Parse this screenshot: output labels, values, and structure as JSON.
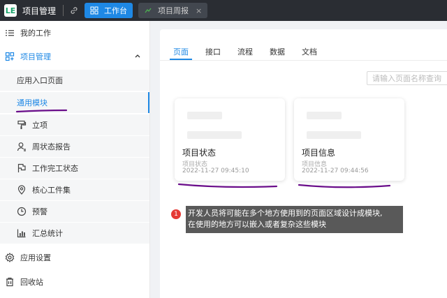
{
  "topbar": {
    "logo_text": "LE",
    "app_title": "项目管理",
    "tabs": [
      {
        "label": "工作台",
        "active": true
      },
      {
        "label": "项目周报",
        "active": false,
        "close": "×"
      }
    ]
  },
  "sidebar": {
    "items": [
      {
        "label": "我的工作",
        "icon": "list-icon"
      },
      {
        "label": "项目管理",
        "icon": "grid-icon",
        "expanded": true
      },
      {
        "label": "应用入口页面"
      },
      {
        "label": "通用模块",
        "active": true
      },
      {
        "label": "立项",
        "icon": "paint-roller-icon"
      },
      {
        "label": "周状态报告",
        "icon": "user-report-icon"
      },
      {
        "label": "工作完工状态",
        "icon": "flag-icon"
      },
      {
        "label": "核心工件集",
        "icon": "location-pin-icon"
      },
      {
        "label": "预警",
        "icon": "clock-icon"
      },
      {
        "label": "汇总统计",
        "icon": "bar-chart-icon"
      },
      {
        "label": "应用设置",
        "icon": "gear-icon"
      },
      {
        "label": "回收站",
        "icon": "trash-icon"
      }
    ]
  },
  "main": {
    "tabs": [
      {
        "label": "页面",
        "active": true
      },
      {
        "label": "接口"
      },
      {
        "label": "流程"
      },
      {
        "label": "数据"
      },
      {
        "label": "文档"
      }
    ],
    "search_placeholder": "请输入页面名称查询",
    "cards": [
      {
        "title": "项目状态",
        "subtitle": "项目状态",
        "date": "2022-11-27 09:45:10"
      },
      {
        "title": "项目信息",
        "subtitle": "项目信息",
        "date": "2022-11-27 09:44:56"
      }
    ]
  },
  "annotation": {
    "number": "1",
    "text_line1": "开发人员将可能在多个地方使用到的页面区域设计成模块,",
    "text_line2": "在使用的地方可以嵌入或者复杂这些模块"
  },
  "colors": {
    "accent": "#1e88e5",
    "topbar": "#2a2d33",
    "logo": "#1aa36b",
    "annotation_marker": "#e53935",
    "scribble": "#6a0d8a"
  }
}
